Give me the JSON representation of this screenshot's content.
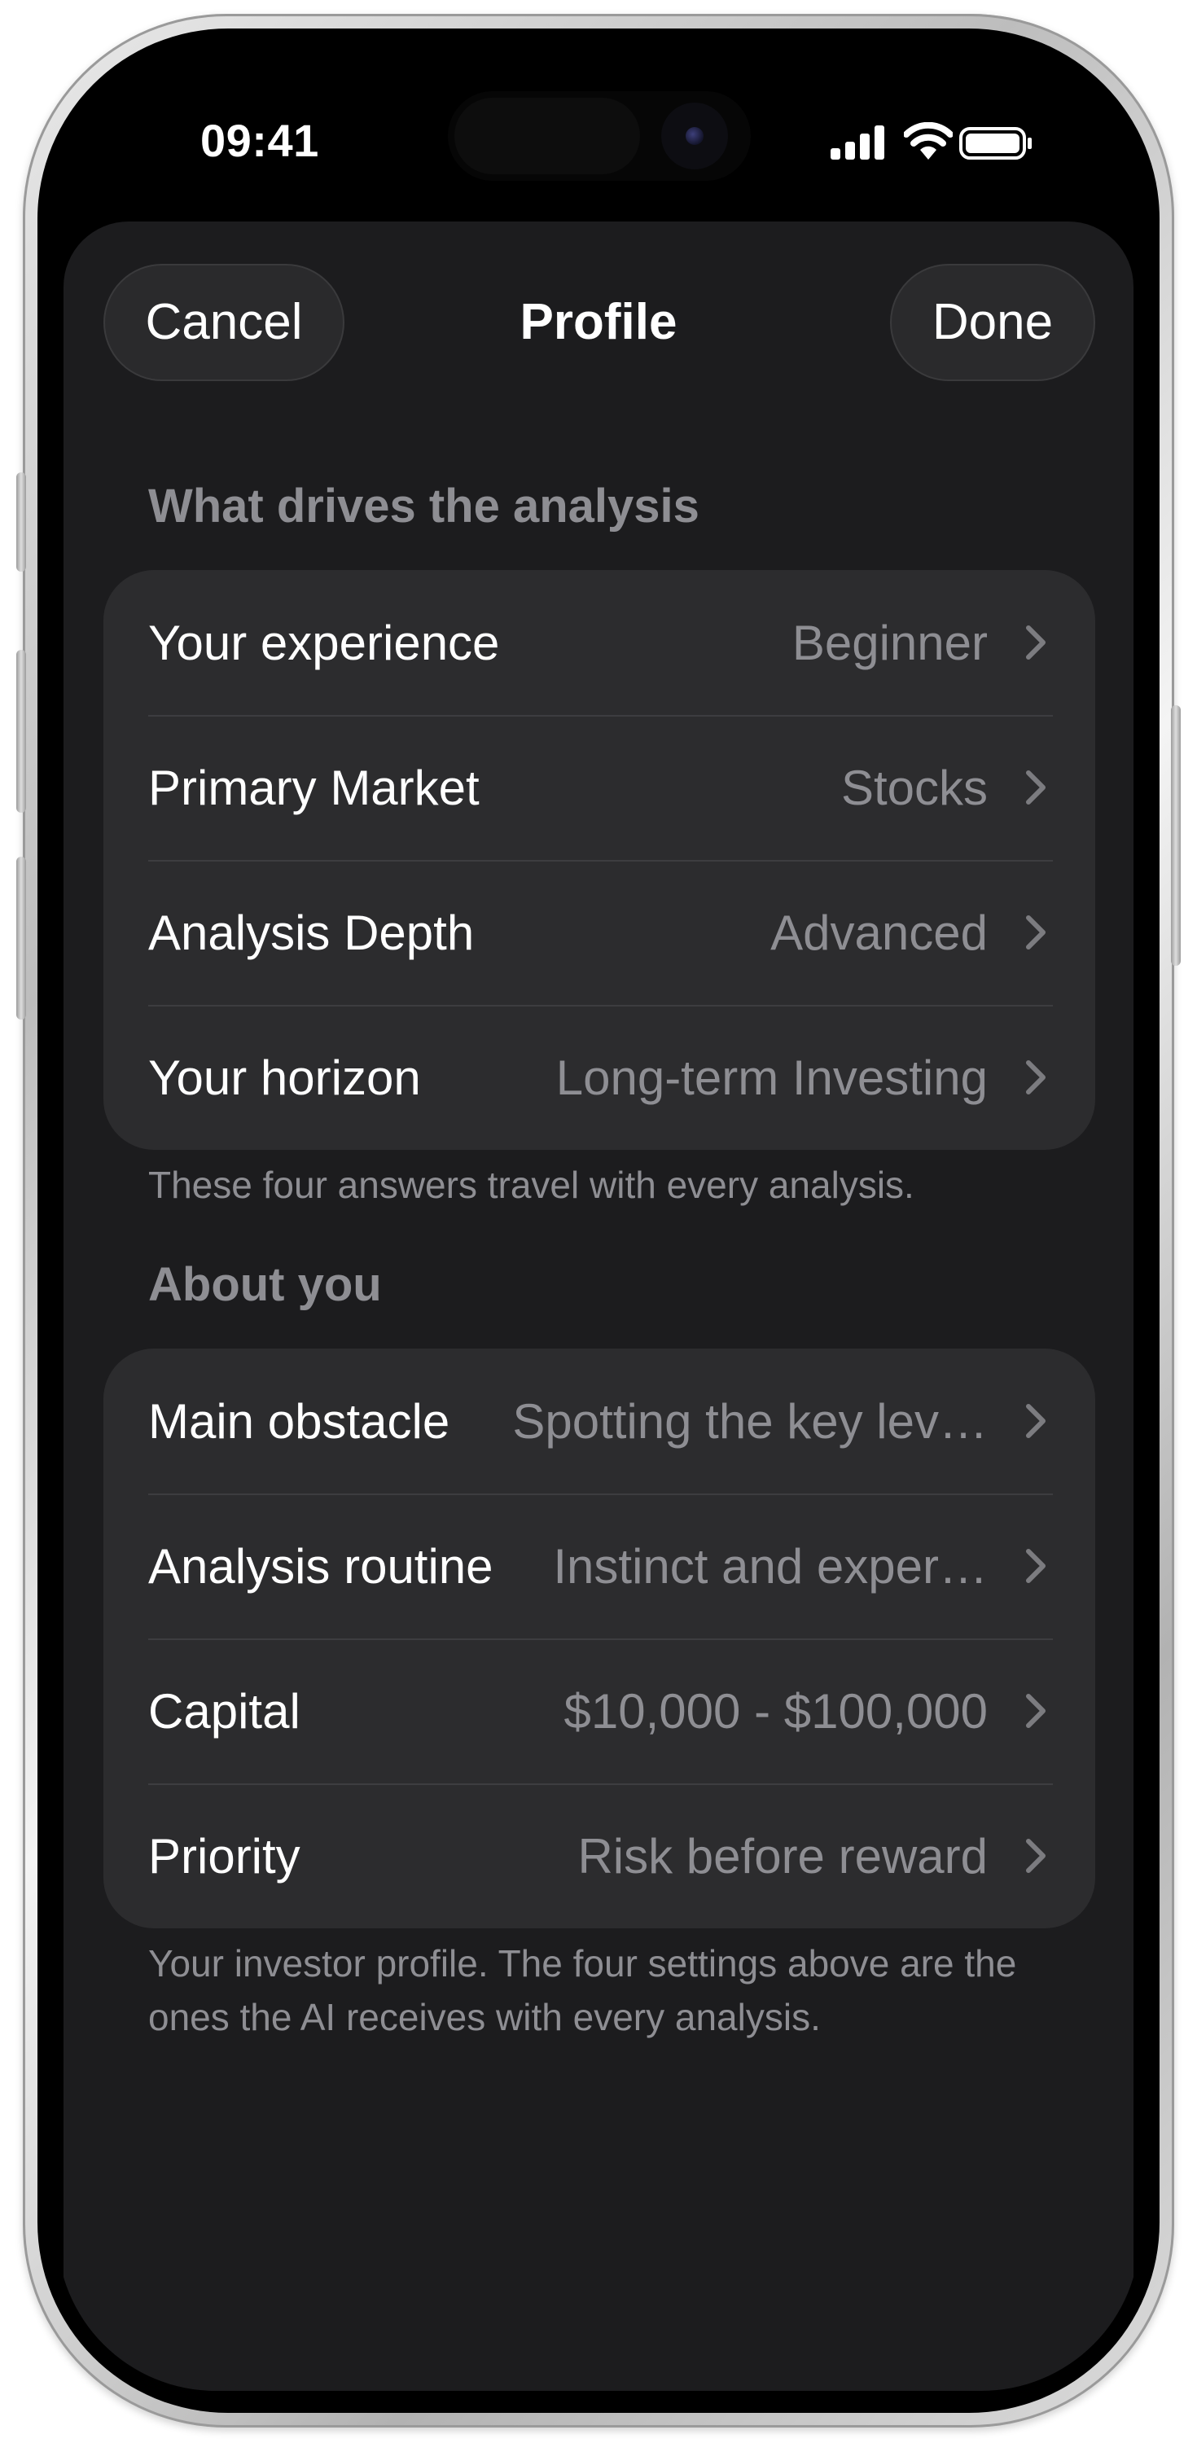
{
  "status_bar": {
    "time": "09:41",
    "signal_icon": "cellular-signal-icon",
    "wifi_icon": "wifi-icon",
    "battery_icon": "battery-icon"
  },
  "nav": {
    "cancel_label": "Cancel",
    "title": "Profile",
    "done_label": "Done"
  },
  "section1": {
    "header": "What drives the analysis",
    "rows": [
      {
        "label": "Your experience",
        "value": "Beginner"
      },
      {
        "label": "Primary Market",
        "value": "Stocks"
      },
      {
        "label": "Analysis Depth",
        "value": "Advanced"
      },
      {
        "label": "Your horizon",
        "value": "Long-term Investing"
      }
    ],
    "footer": "These four answers travel with every analysis."
  },
  "section2": {
    "header": "About you",
    "rows": [
      {
        "label": "Main obstacle",
        "value": "Spotting the key lev…"
      },
      {
        "label": "Analysis routine",
        "value": "Instinct and exper…"
      },
      {
        "label": "Capital",
        "value": "$10,000 - $100,000"
      },
      {
        "label": "Priority",
        "value": "Risk before reward"
      }
    ],
    "footer": "Your investor profile. The four settings above are the ones the AI receives with every analysis."
  },
  "colors": {
    "background": "#000000",
    "sheet": "#1c1c1e",
    "card": "#2c2c2e",
    "primary_text": "#ffffff",
    "secondary_text": "#8e8e93",
    "separator": "#3d3d40"
  }
}
